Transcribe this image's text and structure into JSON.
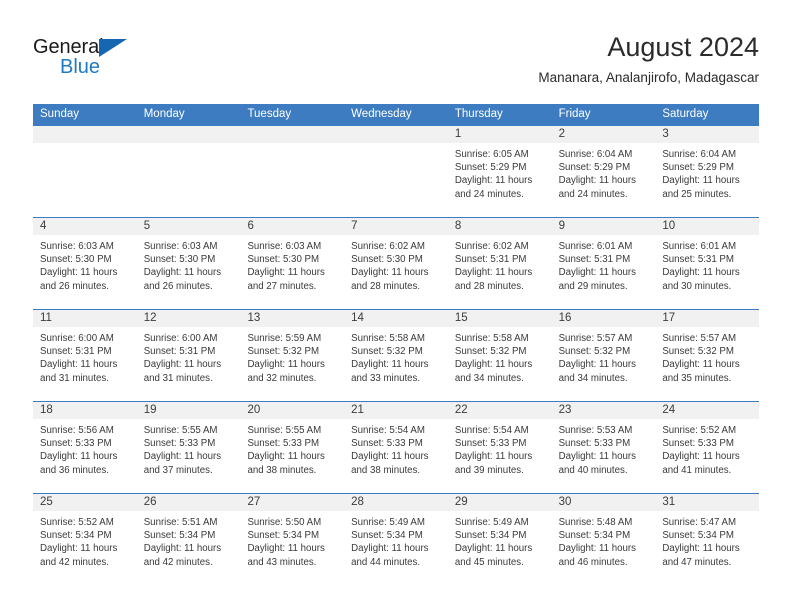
{
  "logo": {
    "word_one": "General",
    "word_two": "Blue",
    "triangle_color": "#1667b2",
    "blue_color": "#1f7ac4"
  },
  "header": {
    "title": "August 2024",
    "subtitle": "Mananara, Analanjirofo, Madagascar"
  },
  "theme": {
    "header_blue": "#3d7cc0",
    "row_divider": "#3d7cc0",
    "daynum_band": "#f1f1f1",
    "text": "#3a3a3a"
  },
  "weekdays": [
    "Sunday",
    "Monday",
    "Tuesday",
    "Wednesday",
    "Thursday",
    "Friday",
    "Saturday"
  ],
  "weeks": [
    [
      {
        "day": "",
        "sunrise": "",
        "sunset": "",
        "daylight": ""
      },
      {
        "day": "",
        "sunrise": "",
        "sunset": "",
        "daylight": ""
      },
      {
        "day": "",
        "sunrise": "",
        "sunset": "",
        "daylight": ""
      },
      {
        "day": "",
        "sunrise": "",
        "sunset": "",
        "daylight": ""
      },
      {
        "day": "1",
        "sunrise": "Sunrise: 6:05 AM",
        "sunset": "Sunset: 5:29 PM",
        "daylight": "Daylight: 11 hours and 24 minutes."
      },
      {
        "day": "2",
        "sunrise": "Sunrise: 6:04 AM",
        "sunset": "Sunset: 5:29 PM",
        "daylight": "Daylight: 11 hours and 24 minutes."
      },
      {
        "day": "3",
        "sunrise": "Sunrise: 6:04 AM",
        "sunset": "Sunset: 5:29 PM",
        "daylight": "Daylight: 11 hours and 25 minutes."
      }
    ],
    [
      {
        "day": "4",
        "sunrise": "Sunrise: 6:03 AM",
        "sunset": "Sunset: 5:30 PM",
        "daylight": "Daylight: 11 hours and 26 minutes."
      },
      {
        "day": "5",
        "sunrise": "Sunrise: 6:03 AM",
        "sunset": "Sunset: 5:30 PM",
        "daylight": "Daylight: 11 hours and 26 minutes."
      },
      {
        "day": "6",
        "sunrise": "Sunrise: 6:03 AM",
        "sunset": "Sunset: 5:30 PM",
        "daylight": "Daylight: 11 hours and 27 minutes."
      },
      {
        "day": "7",
        "sunrise": "Sunrise: 6:02 AM",
        "sunset": "Sunset: 5:30 PM",
        "daylight": "Daylight: 11 hours and 28 minutes."
      },
      {
        "day": "8",
        "sunrise": "Sunrise: 6:02 AM",
        "sunset": "Sunset: 5:31 PM",
        "daylight": "Daylight: 11 hours and 28 minutes."
      },
      {
        "day": "9",
        "sunrise": "Sunrise: 6:01 AM",
        "sunset": "Sunset: 5:31 PM",
        "daylight": "Daylight: 11 hours and 29 minutes."
      },
      {
        "day": "10",
        "sunrise": "Sunrise: 6:01 AM",
        "sunset": "Sunset: 5:31 PM",
        "daylight": "Daylight: 11 hours and 30 minutes."
      }
    ],
    [
      {
        "day": "11",
        "sunrise": "Sunrise: 6:00 AM",
        "sunset": "Sunset: 5:31 PM",
        "daylight": "Daylight: 11 hours and 31 minutes."
      },
      {
        "day": "12",
        "sunrise": "Sunrise: 6:00 AM",
        "sunset": "Sunset: 5:31 PM",
        "daylight": "Daylight: 11 hours and 31 minutes."
      },
      {
        "day": "13",
        "sunrise": "Sunrise: 5:59 AM",
        "sunset": "Sunset: 5:32 PM",
        "daylight": "Daylight: 11 hours and 32 minutes."
      },
      {
        "day": "14",
        "sunrise": "Sunrise: 5:58 AM",
        "sunset": "Sunset: 5:32 PM",
        "daylight": "Daylight: 11 hours and 33 minutes."
      },
      {
        "day": "15",
        "sunrise": "Sunrise: 5:58 AM",
        "sunset": "Sunset: 5:32 PM",
        "daylight": "Daylight: 11 hours and 34 minutes."
      },
      {
        "day": "16",
        "sunrise": "Sunrise: 5:57 AM",
        "sunset": "Sunset: 5:32 PM",
        "daylight": "Daylight: 11 hours and 34 minutes."
      },
      {
        "day": "17",
        "sunrise": "Sunrise: 5:57 AM",
        "sunset": "Sunset: 5:32 PM",
        "daylight": "Daylight: 11 hours and 35 minutes."
      }
    ],
    [
      {
        "day": "18",
        "sunrise": "Sunrise: 5:56 AM",
        "sunset": "Sunset: 5:33 PM",
        "daylight": "Daylight: 11 hours and 36 minutes."
      },
      {
        "day": "19",
        "sunrise": "Sunrise: 5:55 AM",
        "sunset": "Sunset: 5:33 PM",
        "daylight": "Daylight: 11 hours and 37 minutes."
      },
      {
        "day": "20",
        "sunrise": "Sunrise: 5:55 AM",
        "sunset": "Sunset: 5:33 PM",
        "daylight": "Daylight: 11 hours and 38 minutes."
      },
      {
        "day": "21",
        "sunrise": "Sunrise: 5:54 AM",
        "sunset": "Sunset: 5:33 PM",
        "daylight": "Daylight: 11 hours and 38 minutes."
      },
      {
        "day": "22",
        "sunrise": "Sunrise: 5:54 AM",
        "sunset": "Sunset: 5:33 PM",
        "daylight": "Daylight: 11 hours and 39 minutes."
      },
      {
        "day": "23",
        "sunrise": "Sunrise: 5:53 AM",
        "sunset": "Sunset: 5:33 PM",
        "daylight": "Daylight: 11 hours and 40 minutes."
      },
      {
        "day": "24",
        "sunrise": "Sunrise: 5:52 AM",
        "sunset": "Sunset: 5:33 PM",
        "daylight": "Daylight: 11 hours and 41 minutes."
      }
    ],
    [
      {
        "day": "25",
        "sunrise": "Sunrise: 5:52 AM",
        "sunset": "Sunset: 5:34 PM",
        "daylight": "Daylight: 11 hours and 42 minutes."
      },
      {
        "day": "26",
        "sunrise": "Sunrise: 5:51 AM",
        "sunset": "Sunset: 5:34 PM",
        "daylight": "Daylight: 11 hours and 42 minutes."
      },
      {
        "day": "27",
        "sunrise": "Sunrise: 5:50 AM",
        "sunset": "Sunset: 5:34 PM",
        "daylight": "Daylight: 11 hours and 43 minutes."
      },
      {
        "day": "28",
        "sunrise": "Sunrise: 5:49 AM",
        "sunset": "Sunset: 5:34 PM",
        "daylight": "Daylight: 11 hours and 44 minutes."
      },
      {
        "day": "29",
        "sunrise": "Sunrise: 5:49 AM",
        "sunset": "Sunset: 5:34 PM",
        "daylight": "Daylight: 11 hours and 45 minutes."
      },
      {
        "day": "30",
        "sunrise": "Sunrise: 5:48 AM",
        "sunset": "Sunset: 5:34 PM",
        "daylight": "Daylight: 11 hours and 46 minutes."
      },
      {
        "day": "31",
        "sunrise": "Sunrise: 5:47 AM",
        "sunset": "Sunset: 5:34 PM",
        "daylight": "Daylight: 11 hours and 47 minutes."
      }
    ]
  ]
}
